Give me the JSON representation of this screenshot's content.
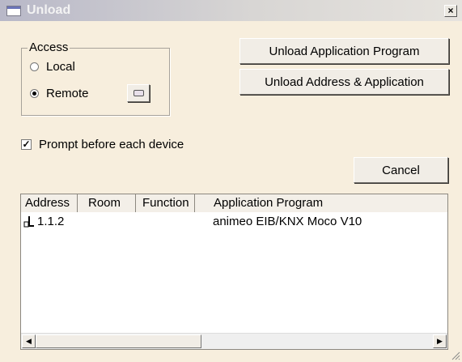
{
  "window": {
    "title": "Unload",
    "close_label": "×"
  },
  "access": {
    "legend": "Access",
    "options": [
      {
        "label": "Local",
        "checked": false
      },
      {
        "label": "Remote",
        "checked": true
      }
    ],
    "settings_icon": "port-icon"
  },
  "buttons": {
    "unload_app": "Unload Application Program",
    "unload_addr_app": "Unload Address & Application",
    "cancel": "Cancel"
  },
  "prompt": {
    "label": "Prompt before each device",
    "checked": true
  },
  "device_list": {
    "columns": [
      "Address",
      "Room",
      "Function",
      "Application Program"
    ],
    "rows": [
      {
        "icon": "device-icon",
        "address": "1.1.2",
        "room": "",
        "function": "",
        "application": "animeo EIB/KNX Moco V10"
      }
    ]
  },
  "colors": {
    "dialog_bg": "#f7eedd",
    "list_bg": "#ffffff"
  }
}
